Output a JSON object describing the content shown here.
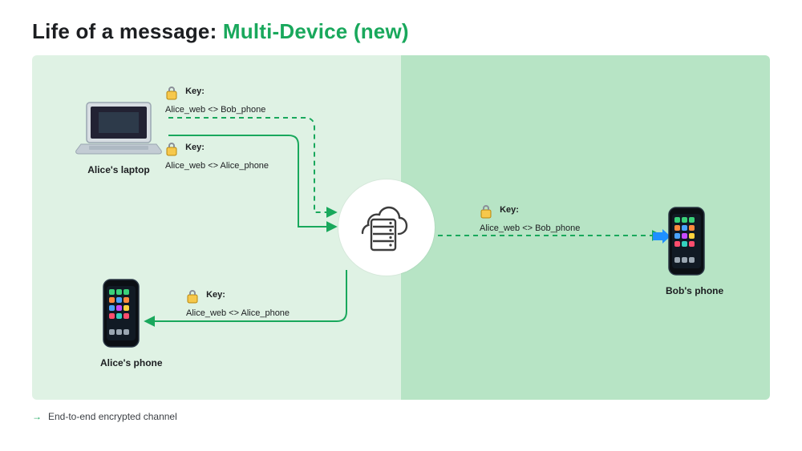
{
  "title_prefix": "Life of a message: ",
  "title_accent": "Multi-Device (new)",
  "colors": {
    "accent": "#19a85c",
    "panel_left": "#dff2e4",
    "panel_right": "#b7e4c5"
  },
  "devices": {
    "alice_laptop": "Alice's laptop",
    "alice_phone": "Alice's phone",
    "bob_phone": "Bob's phone"
  },
  "keys": {
    "k1": {
      "label": "Key:",
      "pair": "Alice_web <> Bob_phone"
    },
    "k2": {
      "label": "Key:",
      "pair": "Alice_web <> Alice_phone"
    },
    "k3": {
      "label": "Key:",
      "pair": "Alice_web <> Alice_phone"
    },
    "k4": {
      "label": "Key:",
      "pair": "Alice_web <> Bob_phone"
    }
  },
  "legend": "End-to-end encrypted channel",
  "channels": [
    {
      "from": "alice_laptop",
      "to": "server",
      "key": "Alice_web <> Bob_phone",
      "style": "dashed"
    },
    {
      "from": "alice_laptop",
      "to": "server",
      "key": "Alice_web <> Alice_phone",
      "style": "solid"
    },
    {
      "from": "server",
      "to": "alice_phone",
      "key": "Alice_web <> Alice_phone",
      "style": "solid"
    },
    {
      "from": "server",
      "to": "bob_phone",
      "key": "Alice_web <> Bob_phone",
      "style": "dashed"
    }
  ]
}
